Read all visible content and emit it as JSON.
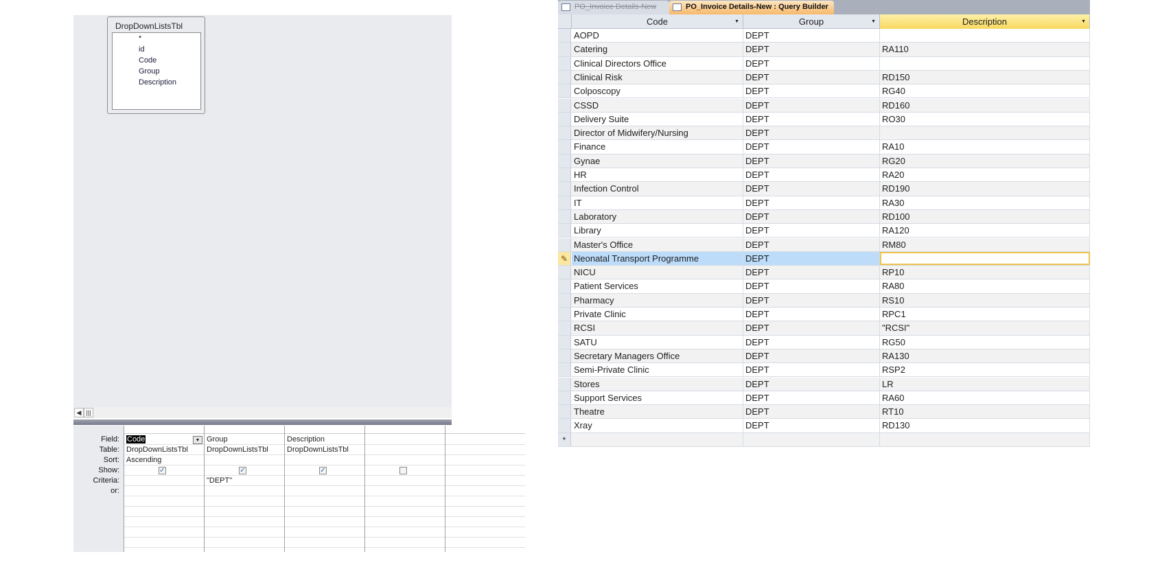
{
  "design": {
    "table": {
      "name": "DropDownListsTbl",
      "fields": [
        "*",
        "id",
        "Code",
        "Group",
        "Description"
      ]
    },
    "grid": {
      "row_labels": [
        "Field:",
        "Table:",
        "Sort:",
        "Show:",
        "Criteria:",
        "or:"
      ],
      "columns": [
        {
          "field": "Code",
          "table": "DropDownListsTbl",
          "sort": "Ascending",
          "show": true,
          "criteria": ""
        },
        {
          "field": "Group",
          "table": "DropDownListsTbl",
          "sort": "",
          "show": true,
          "criteria": "\"DEPT\""
        },
        {
          "field": "Description",
          "table": "DropDownListsTbl",
          "sort": "",
          "show": true,
          "criteria": ""
        },
        {
          "field": "",
          "table": "",
          "sort": "",
          "show": false,
          "criteria": ""
        }
      ]
    }
  },
  "datasheet": {
    "tabs": [
      {
        "label": "PO_Invoice Details-New"
      },
      {
        "label": "PO_Invoice Details-New : Query Builder"
      }
    ],
    "headers": [
      "Code",
      "Group",
      "Description"
    ],
    "current_row": 17,
    "rows": [
      [
        "AOPD",
        "DEPT",
        ""
      ],
      [
        "Catering",
        "DEPT",
        "RA110"
      ],
      [
        "Clinical Directors Office",
        "DEPT",
        ""
      ],
      [
        "Clinical Risk",
        "DEPT",
        "RD150"
      ],
      [
        "Colposcopy",
        "DEPT",
        "RG40"
      ],
      [
        "CSSD",
        "DEPT",
        "RD160"
      ],
      [
        "Delivery Suite",
        "DEPT",
        "RO30"
      ],
      [
        "Director of Midwifery/Nursing",
        "DEPT",
        ""
      ],
      [
        "Finance",
        "DEPT",
        "RA10"
      ],
      [
        "Gynae",
        "DEPT",
        "RG20"
      ],
      [
        "HR",
        "DEPT",
        "RA20"
      ],
      [
        "Infection Control",
        "DEPT",
        "RD190"
      ],
      [
        "IT",
        "DEPT",
        "RA30"
      ],
      [
        "Laboratory",
        "DEPT",
        "RD100"
      ],
      [
        "Library",
        "DEPT",
        "RA120"
      ],
      [
        "Master's Office",
        "DEPT",
        "RM80"
      ],
      [
        "Neonatal Transport Programme",
        "DEPT",
        ""
      ],
      [
        "NICU",
        "DEPT",
        "RP10"
      ],
      [
        "Patient Services",
        "DEPT",
        "RA80"
      ],
      [
        "Pharmacy",
        "DEPT",
        "RS10"
      ],
      [
        "Private Clinic",
        "DEPT",
        "RPC1"
      ],
      [
        "RCSI",
        "DEPT",
        "\"RCSI\""
      ],
      [
        "SATU",
        "DEPT",
        "RG50"
      ],
      [
        "Secretary Managers Office",
        "DEPT",
        "RA130"
      ],
      [
        "Semi-Private Clinic",
        "DEPT",
        "RSP2"
      ],
      [
        "Stores",
        "DEPT",
        "LR"
      ],
      [
        "Support Services",
        "DEPT",
        "RA60"
      ],
      [
        "Theatre",
        "DEPT",
        "RT10"
      ],
      [
        "Xray",
        "DEPT",
        "RD130"
      ]
    ],
    "new_row_marker": "*",
    "edit_marker": "✎"
  }
}
